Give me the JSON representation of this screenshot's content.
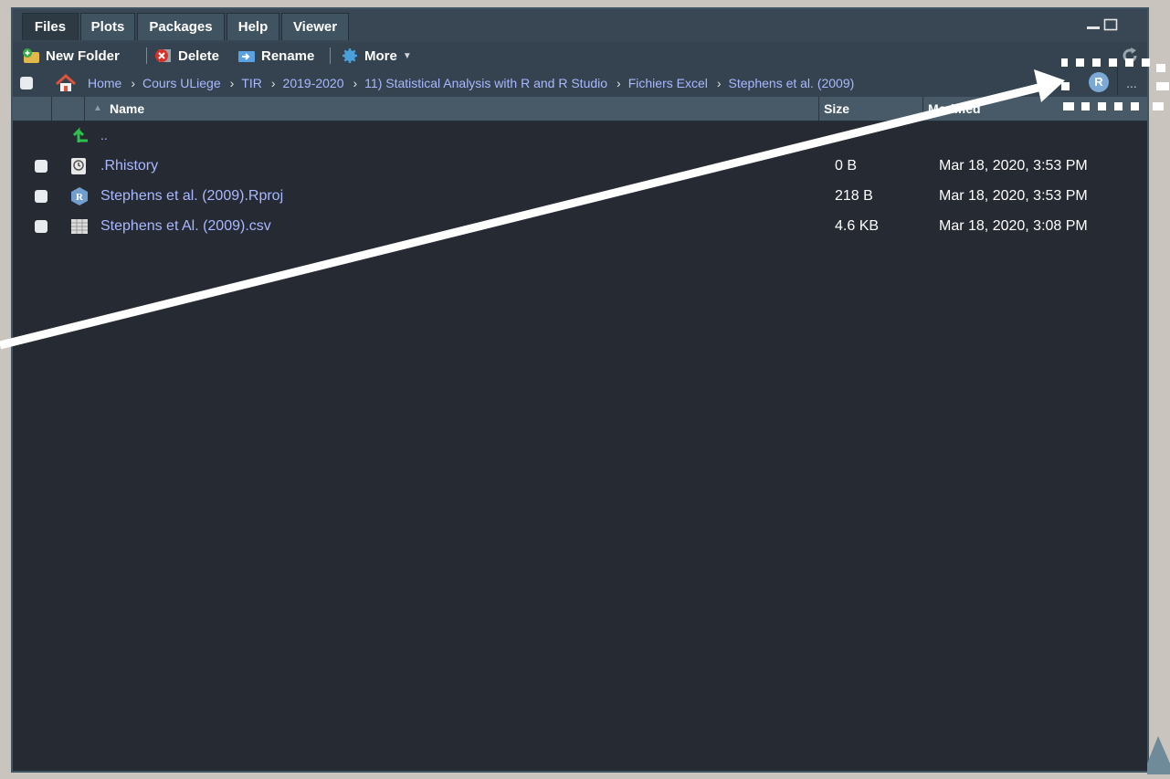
{
  "tabs": [
    {
      "label": "Files",
      "active": true
    },
    {
      "label": "Plots",
      "active": false
    },
    {
      "label": "Packages",
      "active": false
    },
    {
      "label": "Help",
      "active": false
    },
    {
      "label": "Viewer",
      "active": false
    }
  ],
  "toolbar": {
    "new_folder": "New Folder",
    "delete": "Delete",
    "rename": "Rename",
    "more": "More"
  },
  "breadcrumb": [
    "Home",
    "Cours ULiege",
    "TIR",
    "2019-2020",
    "11) Statistical Analysis with R and R Studio",
    "Fichiers Excel",
    "Stephens et al. (2009)"
  ],
  "path_actions": {
    "more": "..."
  },
  "columns": {
    "name": "Name",
    "size": "Size",
    "modified": "Modified"
  },
  "parent_row": {
    "label": ".."
  },
  "files": [
    {
      "name": ".Rhistory",
      "size": "0 B",
      "modified": "Mar 18, 2020, 3:53 PM",
      "icon": "rhistory-icon"
    },
    {
      "name": "Stephens et al. (2009).Rproj",
      "size": "218 B",
      "modified": "Mar 18, 2020, 3:53 PM",
      "icon": "rproj-icon"
    },
    {
      "name": "Stephens et Al. (2009).csv",
      "size": "4.6 KB",
      "modified": "Mar 18, 2020, 3:08 PM",
      "icon": "csv-icon"
    }
  ],
  "project_badge": "R",
  "colors": {
    "pane_bg": "#262a33",
    "toolbar_bg": "#34434f",
    "link": "#a9b8ff",
    "annotation": "#ffffff"
  }
}
